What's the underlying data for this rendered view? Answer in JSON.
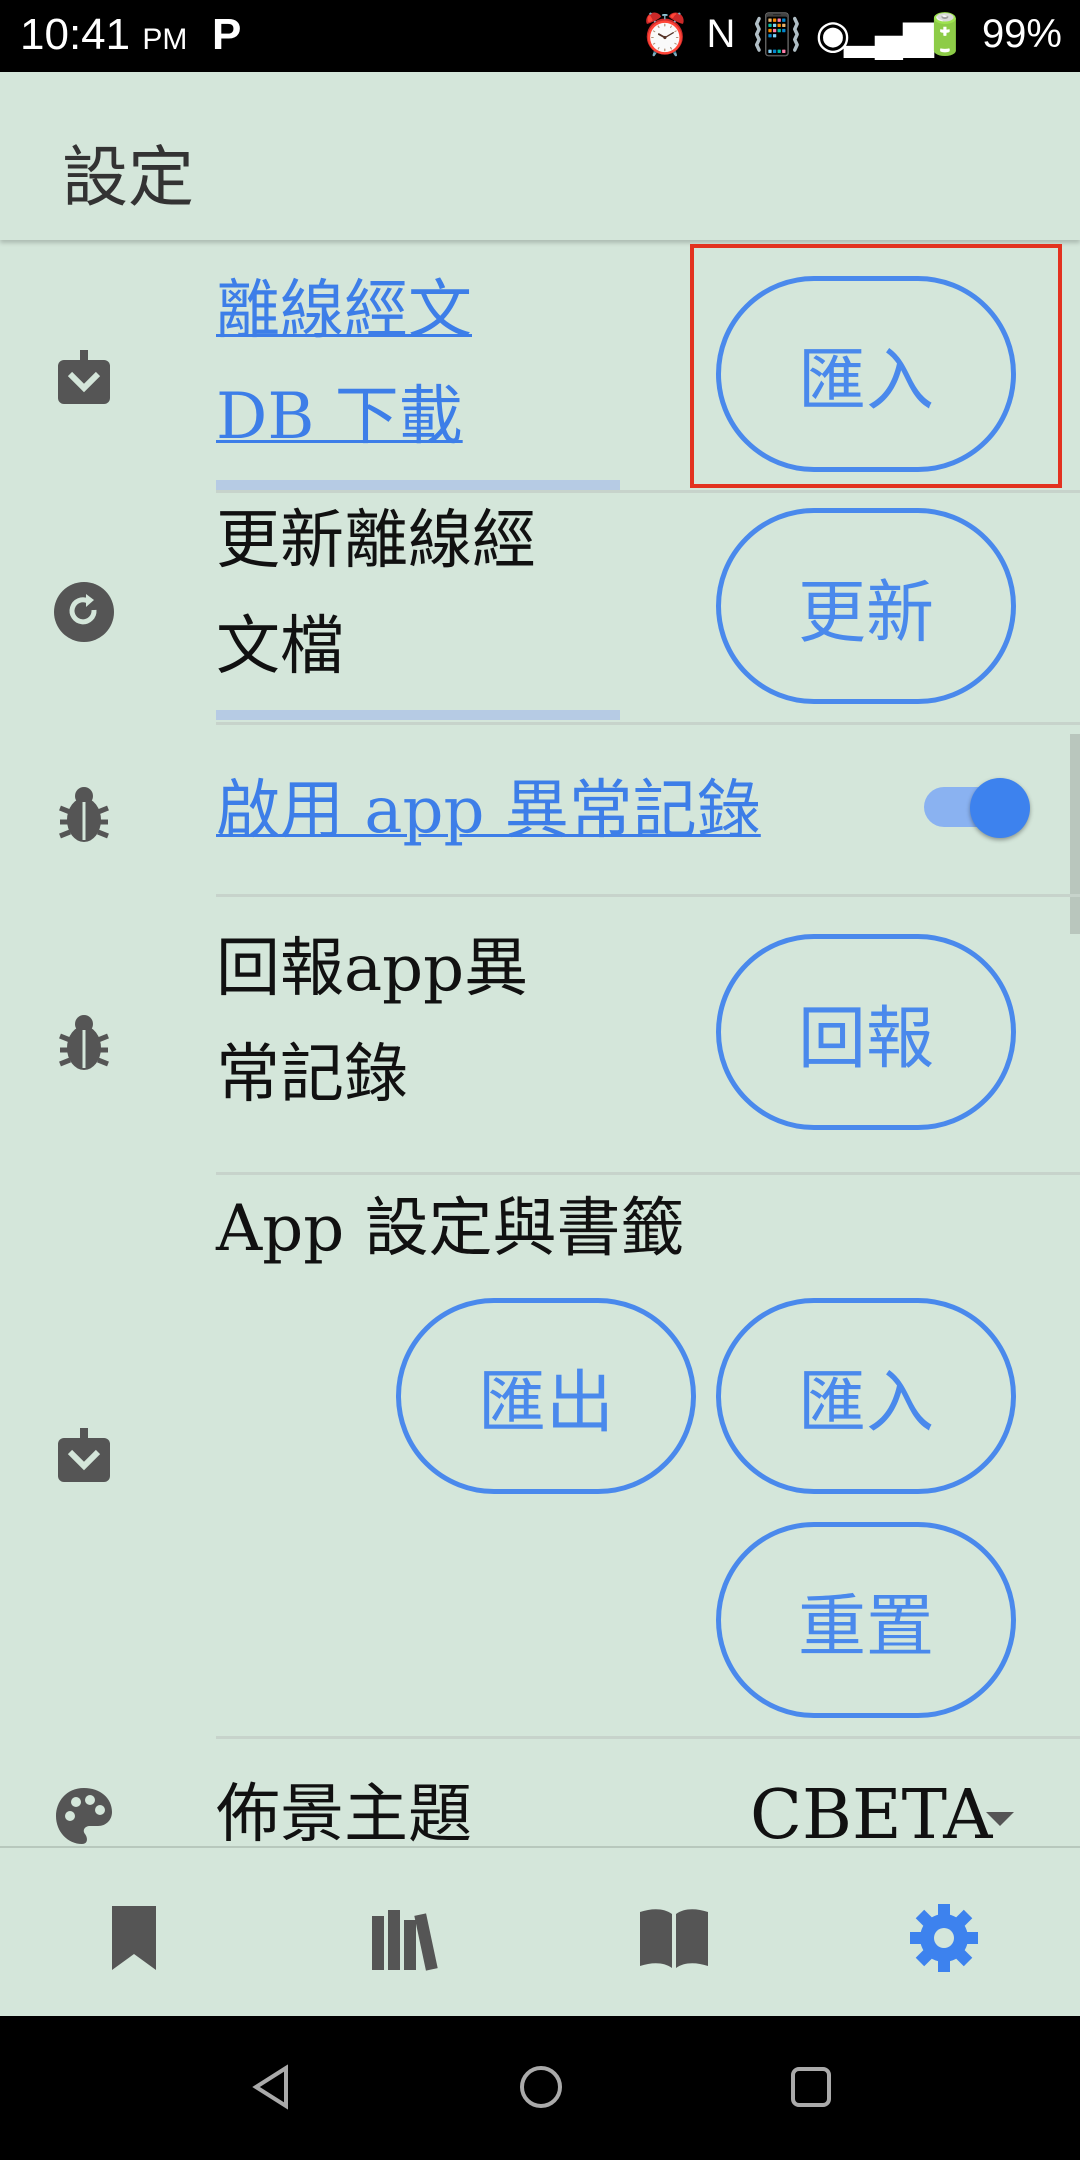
{
  "status_bar": {
    "time": "10:41",
    "ampm": "PM",
    "battery": "99%"
  },
  "app_bar": {
    "title": "設定"
  },
  "settings": {
    "offline_db": {
      "label_line1": "離線經文",
      "label_line2": "DB 下載",
      "button": "匯入"
    },
    "update_offline": {
      "label_line1": "更新離線經",
      "label_line2": "文檔",
      "button": "更新"
    },
    "enable_log": {
      "label": "啟用 app 異常記錄",
      "enabled": true
    },
    "report_log": {
      "label_line1": "回報app異",
      "label_line2": "常記錄",
      "button": "回報"
    },
    "app_settings": {
      "label": "App 設定與書籤",
      "export_button": "匯出",
      "import_button": "匯入",
      "reset_button": "重置"
    },
    "theme": {
      "label": "佈景主題",
      "value": "CBETA"
    }
  },
  "colors": {
    "accent": "#4a89ec",
    "background": "#d4e6da",
    "highlight": "#e3321f"
  }
}
